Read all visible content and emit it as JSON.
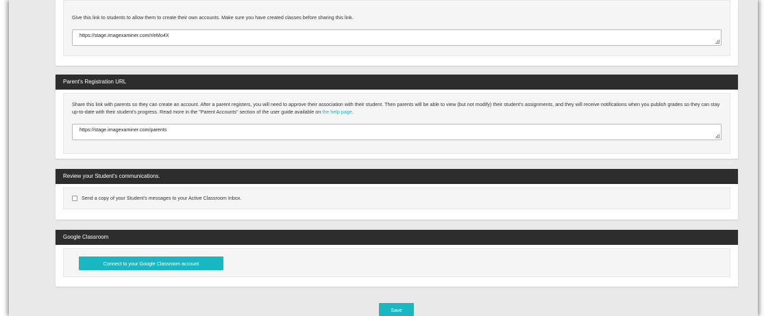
{
  "student_registration": {
    "description": "Give this link to students to allow them to create their own accounts. Make sure you have created classes before sharing this link.",
    "url": "https://stage.imagexaminer.com/r/eMo4X"
  },
  "parent_registration": {
    "title": "Parent's Registration URL",
    "description_before_link": "Share this link with parents so they can create an account. After a parent registers, you will need to approve their association with their student. Then parents will be able to view (but not modify) their student's assignments, and they will receive notifications when you publish grades so they can stay up-to-date with their student's progress. Read more in the \"Parent Accounts\" section of the user guide available on ",
    "help_link": "the help page",
    "description_after_link": ".",
    "url": "https://stage.imagexaminer.com/parents"
  },
  "communications": {
    "title": "Review your Student's communications.",
    "checkbox_label": "Send a copy of your Student's messages to your Active Classroom Inbox."
  },
  "google_classroom": {
    "title": "Google Classroom",
    "connect_button": "Connect to your Google Classroom account"
  },
  "footer": {
    "save_button": "Save"
  },
  "colors": {
    "accent": "#18b7c2",
    "header_bg": "#2d2d2d",
    "page_bg": "#e9e9e9"
  }
}
